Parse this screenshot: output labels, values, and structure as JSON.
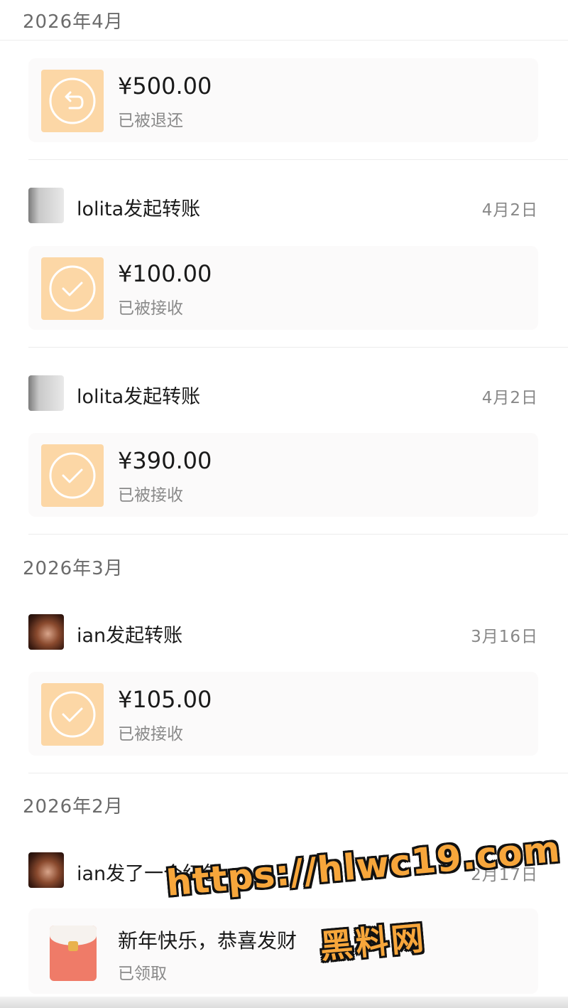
{
  "sections": [
    {
      "month": "2026年4月"
    },
    {
      "month": "2026年3月"
    },
    {
      "month": "2026年2月"
    }
  ],
  "transfers": [
    {
      "amount": "¥500.00",
      "status": "已被退还",
      "icon": "return-arrow-icon"
    },
    {
      "sender": "lolita发起转账",
      "date": "4月2日",
      "amount": "¥100.00",
      "status": "已被接收",
      "icon": "check-circle-icon"
    },
    {
      "sender": "lolita发起转账",
      "date": "4月2日",
      "amount": "¥390.00",
      "status": "已被接收",
      "icon": "check-circle-icon"
    },
    {
      "sender": "ian发起转账",
      "date": "3月16日",
      "amount": "¥105.00",
      "status": "已被接收",
      "icon": "check-circle-icon"
    }
  ],
  "red_packet": {
    "sender": "ian发了一个红包",
    "date": "2月17日",
    "message": "新年快乐，恭喜发财",
    "status": "已领取",
    "icon": "red-packet-icon"
  },
  "watermark": {
    "url": "https://hlwc19.com",
    "name": "黑料网"
  },
  "colors": {
    "icon_bg": "#fcd7a6",
    "red_packet": "#ef7b68",
    "watermark": "#f7a63b"
  }
}
